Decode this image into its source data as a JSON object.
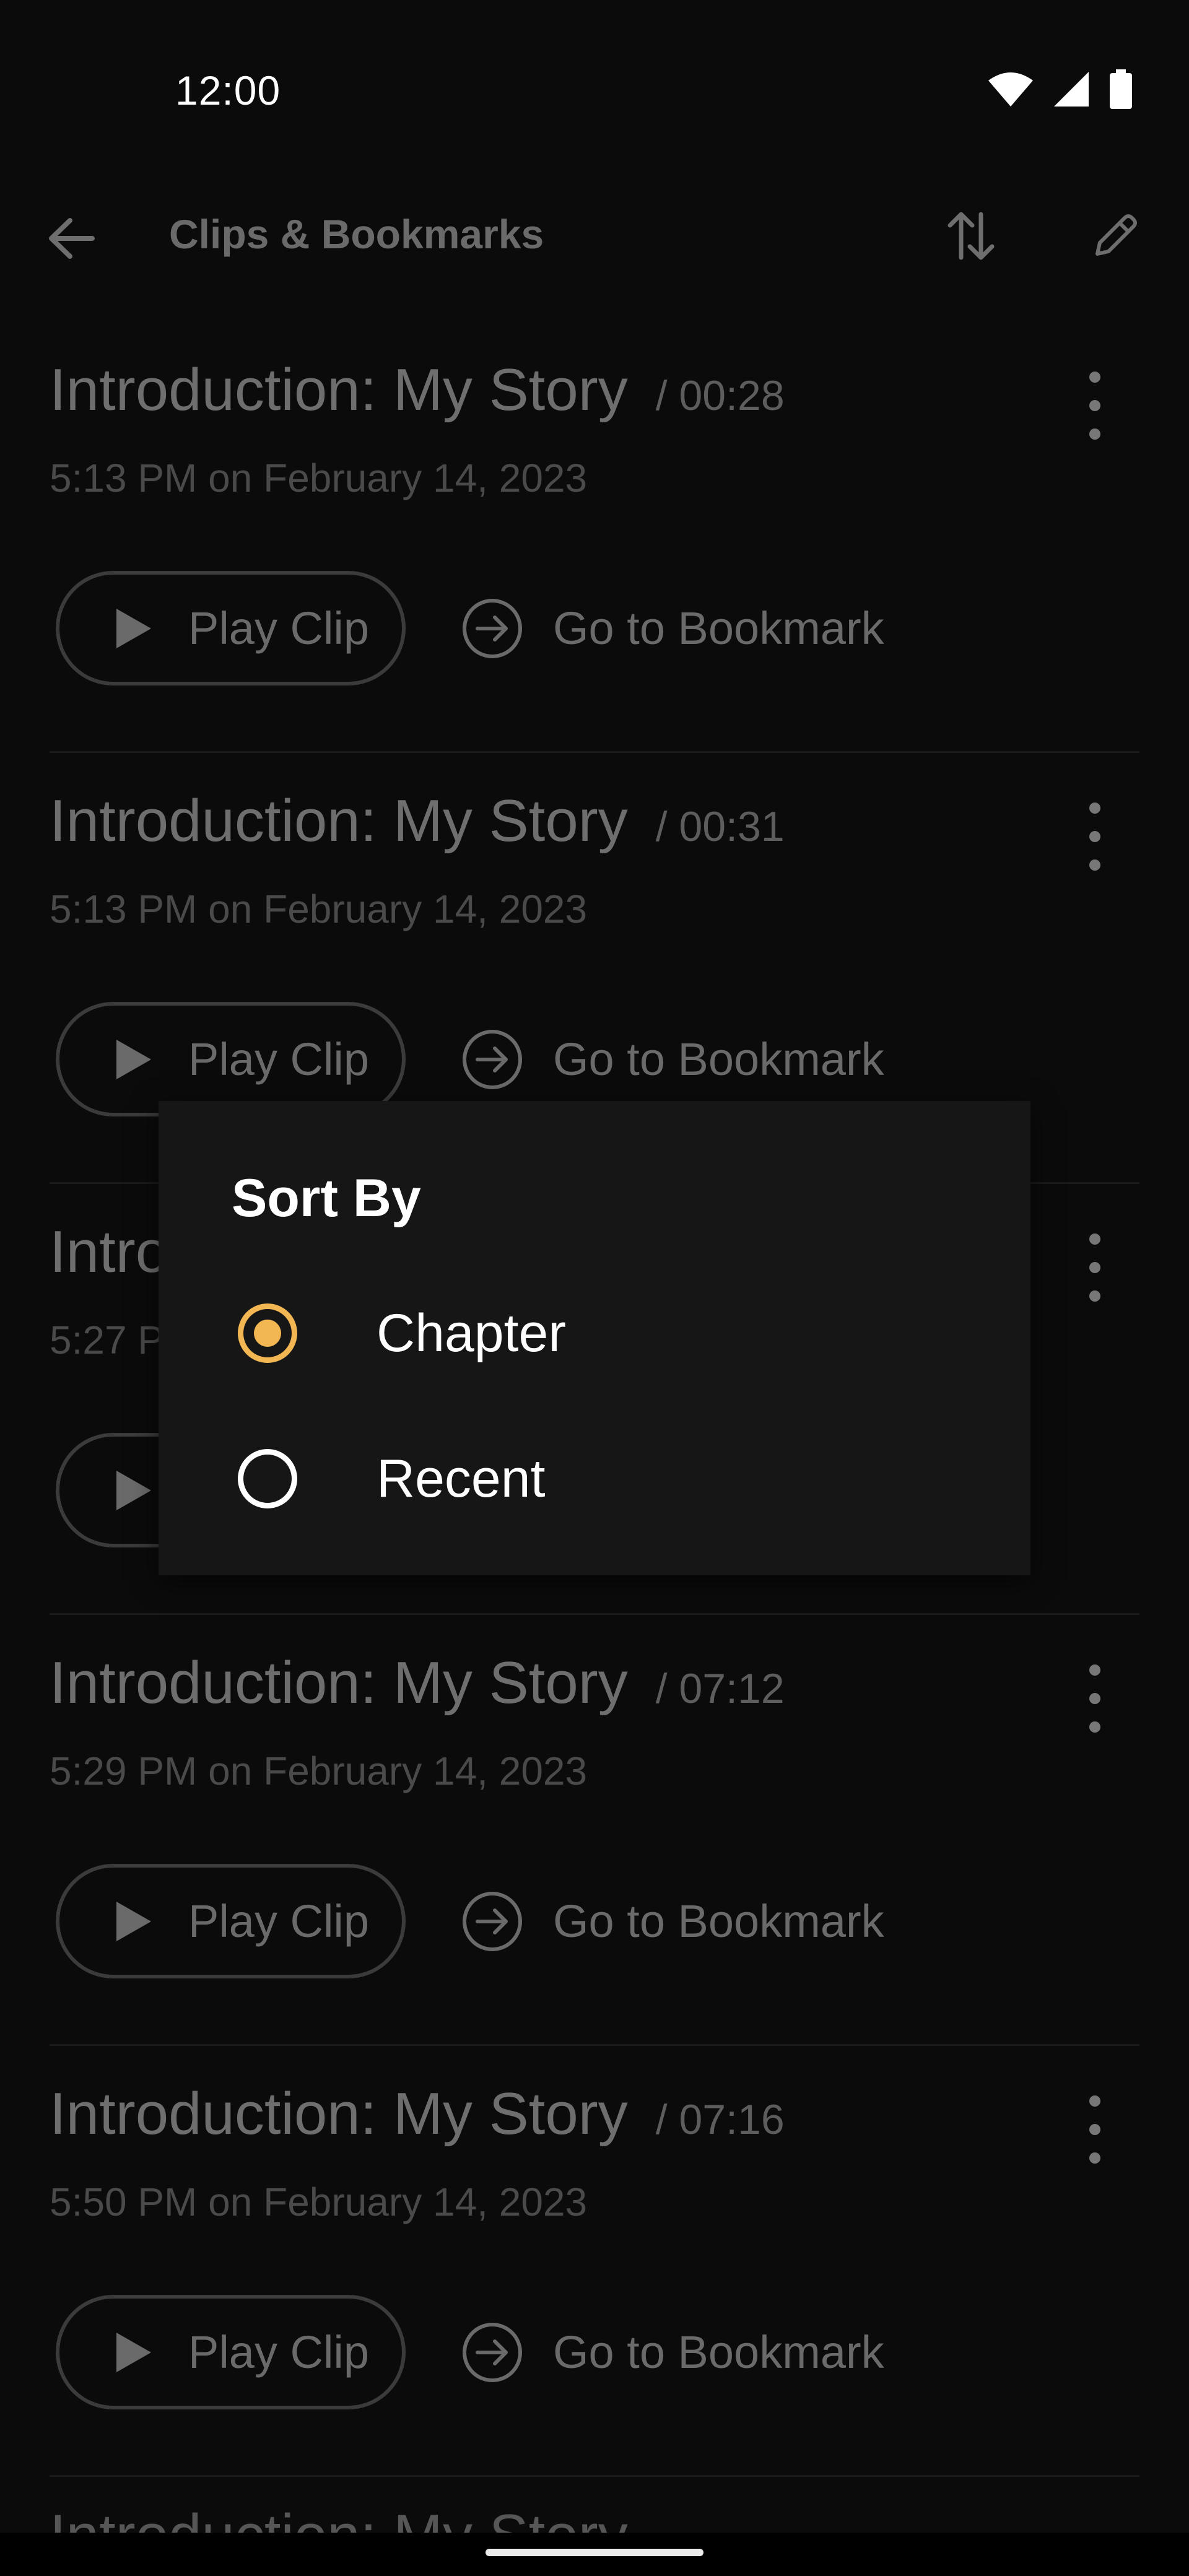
{
  "status_bar": {
    "time": "12:00",
    "icons": [
      "wifi-icon",
      "signal-icon",
      "battery-icon"
    ]
  },
  "app_bar": {
    "title": "Clips & Bookmarks",
    "back_icon": "arrow-left-icon",
    "sort_icon": "sort-arrows-icon",
    "edit_icon": "pencil-icon"
  },
  "clips": [
    {
      "title": "Introduction: My Story",
      "time": "/ 00:28",
      "date": "5:13 PM on February 14, 2023",
      "play_label": "Play Clip",
      "goto_label": "Go to Bookmark"
    },
    {
      "title": "Introduction: My Story",
      "time": "/ 00:31",
      "date": "5:13 PM on February 14, 2023",
      "play_label": "Play Clip",
      "goto_label": "Go to Bookmark"
    },
    {
      "title": "Intro",
      "time": "",
      "date": "5:27 P",
      "play_label": "",
      "goto_label": ""
    },
    {
      "title": "Introduction: My Story",
      "time": "/ 07:12",
      "date": "5:29 PM on February 14, 2023",
      "play_label": "Play Clip",
      "goto_label": "Go to Bookmark"
    },
    {
      "title": "Introduction: My Story",
      "time": "/ 07:16",
      "date": "5:50 PM on February 14, 2023",
      "play_label": "Play Clip",
      "goto_label": "Go to Bookmark"
    }
  ],
  "partial_item_title": "Introduction: My Story",
  "sort_dialog": {
    "title": "Sort By",
    "options": [
      {
        "label": "Chapter",
        "selected": true
      },
      {
        "label": "Recent",
        "selected": false
      }
    ],
    "accent_color": "#f2b652"
  }
}
